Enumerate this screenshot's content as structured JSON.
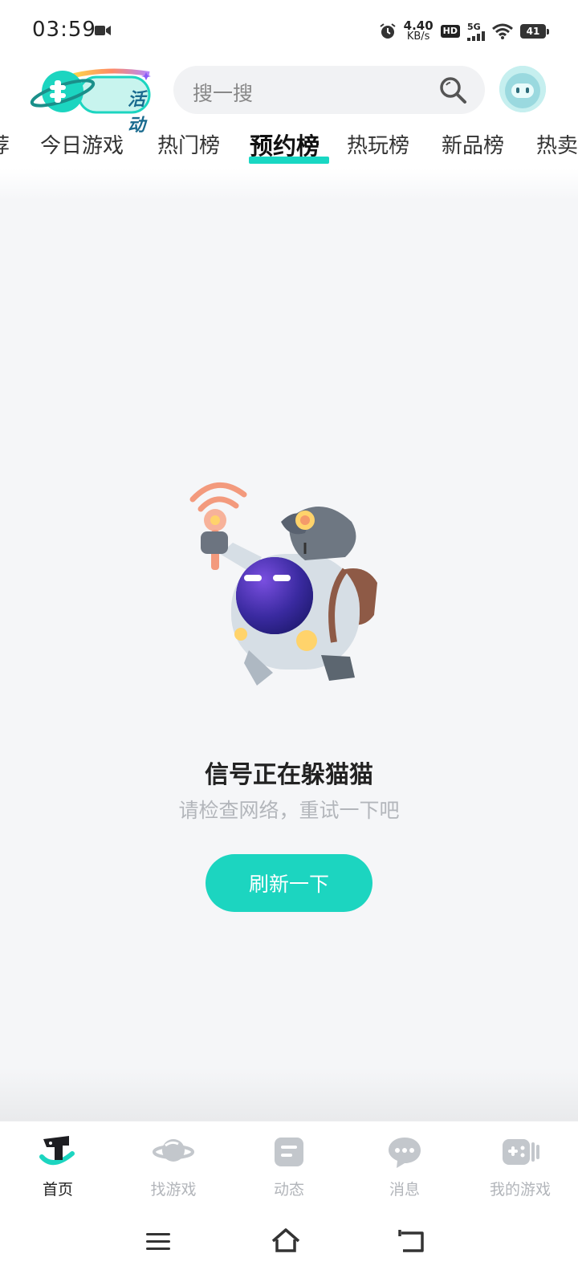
{
  "status_bar": {
    "time": "03:59",
    "net_speed_value": "4.40",
    "net_speed_unit": "KB/s",
    "hd": "HD",
    "signal": "5G",
    "battery": "41"
  },
  "header": {
    "activity_label": "活动",
    "search_placeholder": "搜一搜"
  },
  "tabs": [
    {
      "label": "荐"
    },
    {
      "label": "今日游戏"
    },
    {
      "label": "热门榜"
    },
    {
      "label": "预约榜",
      "active": true
    },
    {
      "label": "热玩榜"
    },
    {
      "label": "新品榜"
    },
    {
      "label": "热卖"
    }
  ],
  "empty_state": {
    "title": "信号正在躲猫猫",
    "subtitle": "请检查网络，重试一下吧",
    "refresh_label": "刷新一下"
  },
  "bottom_nav": [
    {
      "label": "首页",
      "icon": "home-icon",
      "active": true
    },
    {
      "label": "找游戏",
      "icon": "planet-icon"
    },
    {
      "label": "动态",
      "icon": "feed-icon"
    },
    {
      "label": "消息",
      "icon": "message-icon"
    },
    {
      "label": "我的游戏",
      "icon": "gamepad-icon"
    }
  ],
  "colors": {
    "accent": "#1cd5c0",
    "inactive": "#b2b5ba"
  }
}
